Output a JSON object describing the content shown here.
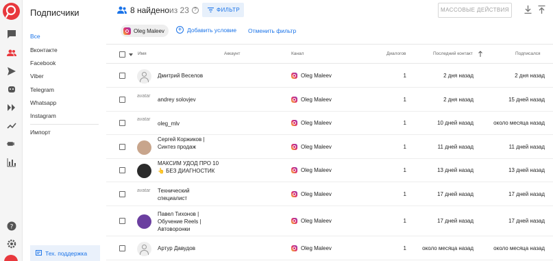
{
  "rail": {
    "icons": [
      "logo",
      "chat-icon",
      "subscribers-icon",
      "send-icon",
      "bot-icon",
      "automation-icon",
      "analytics-icon",
      "integrations-icon",
      "stats-icon",
      "help-icon",
      "settings-icon"
    ]
  },
  "sidebar": {
    "title": "Подписчики",
    "items": [
      {
        "label": "Все",
        "active": true
      },
      {
        "label": "Вконтакте"
      },
      {
        "label": "Facebook"
      },
      {
        "label": "Viber"
      },
      {
        "label": "Telegram"
      },
      {
        "label": "Whatsapp"
      },
      {
        "label": "Instagram"
      }
    ],
    "import_label": "Импорт",
    "support_label": "Тех. поддержка"
  },
  "header": {
    "found": "8 найдено",
    "of_total": "из 23",
    "filter_label": "ФИЛЬТР",
    "bulk_label": "МАССОВЫЕ ДЕЙСТВИЯ"
  },
  "filterbar": {
    "chip_label": "Oleg Maleev",
    "add_condition": "Добавить условие",
    "cancel_filter": "Отменить фильтр"
  },
  "table": {
    "columns": {
      "name": "Имя",
      "account": "Аккаунт",
      "channel": "Канал",
      "dialogs": "Диалогов",
      "last_contact": "Последний контакт",
      "subscribed": "Подписался"
    },
    "avatar_alt": "avatar",
    "rows": [
      {
        "name": "Дмитрий Веселов",
        "avatar": "placeholder",
        "channel": "Oleg Maleev",
        "dialogs": "1",
        "last": "2 дня назад",
        "subs": "2 дня назад"
      },
      {
        "name": "andrey solovjev",
        "avatar": "broken",
        "channel": "Oleg Maleev",
        "dialogs": "1",
        "last": "2 дня назад",
        "subs": "15 дней назад"
      },
      {
        "name": "oleg_mlv",
        "avatar": "broken",
        "channel": "Oleg Maleev",
        "dialogs": "1",
        "last": "10 дней назад",
        "subs": "около месяца назад"
      },
      {
        "name": "Сергей Коржиков | Синтез продаж",
        "avatar": "photo",
        "channel": "Oleg Maleev",
        "dialogs": "1",
        "last": "11 дней назад",
        "subs": "11 дней назад"
      },
      {
        "name": "МАКСИМ УДОД ПРО 10 👆 БЕЗ ДИАГНОСТИК",
        "avatar": "photo-dark",
        "channel": "Oleg Maleev",
        "dialogs": "1",
        "last": "13 дней назад",
        "subs": "13 дней назад"
      },
      {
        "name": "Технический специалист",
        "avatar": "broken",
        "channel": "Oleg Maleev",
        "dialogs": "1",
        "last": "17 дней назад",
        "subs": "17 дней назад"
      },
      {
        "name": "Павел Тихонов | Обучение Reels | Автоворонки",
        "avatar": "photo-purple",
        "channel": "Oleg Maleev",
        "dialogs": "1",
        "last": "17 дней назад",
        "subs": "17 дней назад"
      },
      {
        "name": "Артур Давудов",
        "avatar": "placeholder",
        "channel": "Oleg Maleev",
        "dialogs": "1",
        "last": "около месяца назад",
        "subs": "около месяца назад"
      }
    ]
  }
}
